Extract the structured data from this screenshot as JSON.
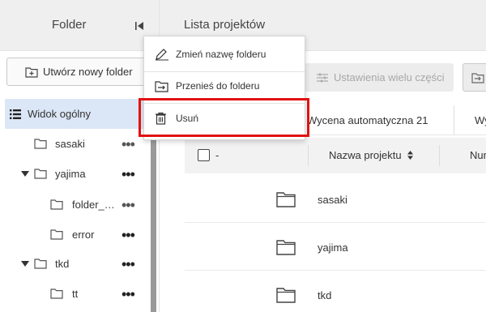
{
  "left_panel": {
    "title": "Folder",
    "create_button": "Utwórz nowy folder",
    "tree": [
      {
        "label": "Widok ogólny",
        "type": "overview",
        "active": true
      },
      {
        "label": "sasaki",
        "type": "folder",
        "level": 1,
        "expanded": false
      },
      {
        "label": "yajima",
        "type": "folder",
        "level": 1,
        "expanded": true
      },
      {
        "label": "folder_…",
        "type": "folder",
        "level": 2
      },
      {
        "label": "error",
        "type": "folder",
        "level": 2
      },
      {
        "label": "tkd",
        "type": "folder",
        "level": 1,
        "expanded": true
      },
      {
        "label": "tt",
        "type": "folder",
        "level": 2
      }
    ],
    "dots": "•••"
  },
  "main": {
    "title": "Lista projektów",
    "multi_settings_button": "Ustawienia wielu części",
    "tabs": [
      "Wycena automatyczna 21",
      "Wy"
    ],
    "table": {
      "check_header": "-",
      "columns": [
        "Nazwa projektu",
        "Nur"
      ],
      "rows": [
        "sasaki",
        "yajima",
        "tkd"
      ]
    }
  },
  "context_menu": {
    "items": [
      "Zmień nazwę folderu",
      "Przenieś do folderu",
      "Usuń"
    ],
    "highlighted": "Usuń"
  },
  "colors": {
    "highlight": "#e21212",
    "active_item": "#dbe6f6",
    "header_bg": "#efefef"
  }
}
